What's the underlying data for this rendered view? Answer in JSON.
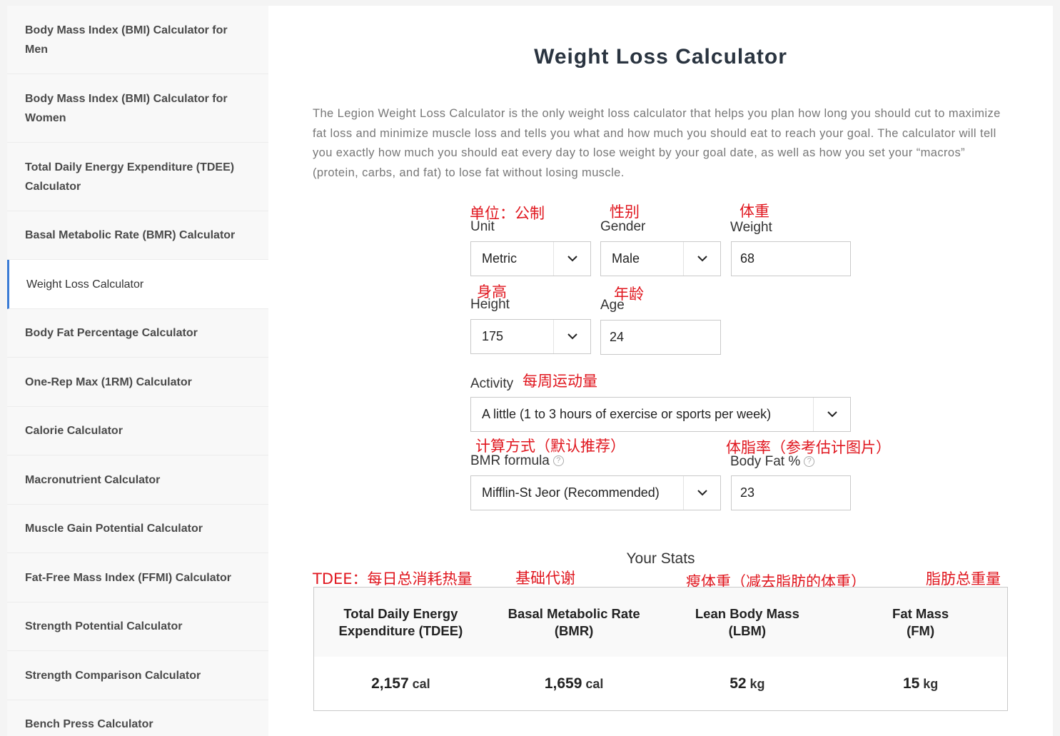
{
  "sidebar": {
    "items": [
      {
        "label": "Body Mass Index (BMI) Calculator for Men"
      },
      {
        "label": "Body Mass Index (BMI) Calculator for Women"
      },
      {
        "label": "Total Daily Energy Expenditure (TDEE) Calculator"
      },
      {
        "label": "Basal Metabolic Rate (BMR) Calculator"
      },
      {
        "label": "Weight Loss Calculator"
      },
      {
        "label": "Body Fat Percentage Calculator"
      },
      {
        "label": "One-Rep Max (1RM) Calculator"
      },
      {
        "label": "Calorie Calculator"
      },
      {
        "label": "Macronutrient Calculator"
      },
      {
        "label": "Muscle Gain Potential Calculator"
      },
      {
        "label": "Fat-Free Mass Index (FFMI) Calculator"
      },
      {
        "label": "Strength Potential Calculator"
      },
      {
        "label": "Strength Comparison Calculator"
      },
      {
        "label": "Bench Press Calculator"
      }
    ]
  },
  "main": {
    "title": "Weight Loss Calculator",
    "intro": "The Legion Weight Loss Calculator is the only weight loss calculator that helps you plan how long you should cut to maximize fat loss and minimize muscle loss and tells you what and how much you should eat to reach your goal. The calculator will tell you exactly how much you should eat every day to lose weight by your goal date, as well as how you set your “macros” (protein, carbs, and fat) to lose fat without losing muscle."
  },
  "annotations": {
    "unit": "单位：公制",
    "gender": "性别",
    "weight": "体重",
    "height": "身高",
    "age": "年龄",
    "activity": "每周运动量",
    "bmr_formula": "计算方式（默认推荐）",
    "body_fat": "体脂率（参考估计图片）",
    "tdee": "TDEE：每日总消耗热量",
    "bmr": "基础代谢",
    "lbm": "瘦体重（减去脂肪的体重）",
    "fm": "脂肪总重量"
  },
  "form": {
    "unit": {
      "label": "Unit",
      "value": "Metric"
    },
    "gender": {
      "label": "Gender",
      "value": "Male"
    },
    "weight": {
      "label": "Weight",
      "value": "68"
    },
    "height": {
      "label": "Height",
      "value": "175"
    },
    "age": {
      "label": "Age",
      "value": "24"
    },
    "activity": {
      "label": "Activity",
      "value": "A little (1 to 3 hours of exercise or sports per week)"
    },
    "bmr_formula": {
      "label": "BMR formula",
      "value": "Mifflin-St Jeor (Recommended)"
    },
    "body_fat": {
      "label": "Body Fat %",
      "value": "23"
    }
  },
  "stats": {
    "title": "Your Stats",
    "columns": [
      {
        "line1": "Total Daily Energy",
        "line2": "Expenditure (TDEE)",
        "value": "2,157",
        "unit": "cal"
      },
      {
        "line1": "Basal Metabolic Rate",
        "line2": "(BMR)",
        "value": "1,659",
        "unit": "cal"
      },
      {
        "line1": "Lean Body Mass",
        "line2": "(LBM)",
        "value": "52",
        "unit": "kg"
      },
      {
        "line1": "Fat Mass",
        "line2": "(FM)",
        "value": "15",
        "unit": "kg"
      }
    ]
  }
}
